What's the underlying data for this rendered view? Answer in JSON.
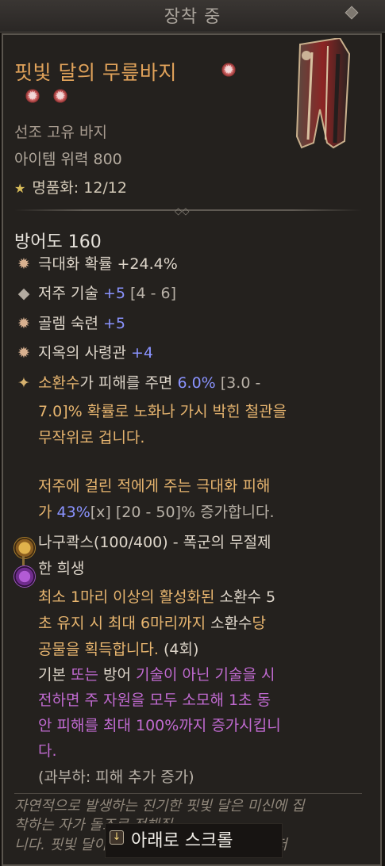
{
  "header": {
    "title": "장착 중"
  },
  "item": {
    "name": "핏빛 달의 무릎바지",
    "type": "선조 고유 바지",
    "power": "아이템 위력 800",
    "mastery": "명품화: 12/12",
    "armor": "방어도 160"
  },
  "stats": [
    {
      "label": "극대화 확률 +24.4%"
    },
    {
      "label": "저주 기술 ",
      "value": "+5",
      "range": " [4 - 6]"
    },
    {
      "label": "골렘 숙련 ",
      "value": "+5"
    },
    {
      "label": "지옥의 사령관 ",
      "value": "+4"
    }
  ],
  "unique_effect": {
    "line1a": "소환수",
    "line1b": "가 피해를 주면 ",
    "line1c": "6.0%",
    "line1d": " [3.0 -",
    "line2": "7.0]% 확률로 노화나 가시 박힌 철관을",
    "line3": "무작위로 겁니다."
  },
  "bonus": {
    "line1a": "저주",
    "line1b": "에 걸린 적에게 주는 극대화 피해",
    "line2a": "가 ",
    "line2b": "43%",
    "line2c": "[x] [20 - 50]% 증가합니다."
  },
  "sealed": {
    "title_line1": "나구콱스(100/400) - 폭군의 무절제",
    "title_line2": "한 희생",
    "line1a": "최소 1마리 이상의 활성화된 ",
    "line1b": "소환수 5",
    "line2a": "초 유지 시 최대 6마리까지 ",
    "line2b": "소환수",
    "line2c": "당",
    "line3a": "공물을 획득합니다. ",
    "line3b": "(4회)",
    "line4a": "기본 ",
    "line4b": "또는 ",
    "line4c": "방어 ",
    "line4d": "기술이 아닌 기술을 시",
    "line5": "전하면 주 자원을 모두 소모해 1초 동",
    "line6": "안 피해를 최대 100%까지 증가시킵니",
    "line7": "다.",
    "line8": "(과부하: 피해 추가 증가)"
  },
  "flavor": {
    "line1": "자연적으로 발생하는 진기한 핏빛 달은 미신에 집",
    "line2": "착하는 자가  돌",
    "line2b": "조로 전해집",
    "line3": "니다. 핏빛 달이 뜨는   태어난 아이들은 종종 저"
  },
  "scroll": {
    "label": "아래로 스크롤"
  }
}
